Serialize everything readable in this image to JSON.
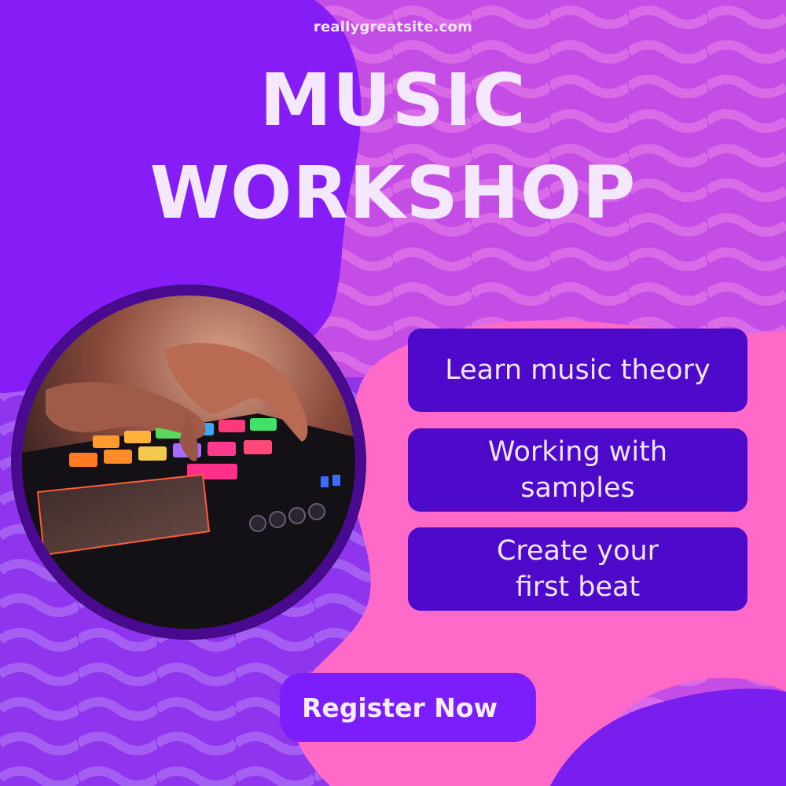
{
  "site": {
    "url": "reallygreatsite.com"
  },
  "headline": {
    "line1": "MUSIC",
    "line2": "WORKSHOP"
  },
  "features": [
    {
      "lines": [
        "Learn music theory"
      ]
    },
    {
      "lines": [
        "Working with",
        "samples"
      ]
    },
    {
      "lines": [
        "Create your",
        "first beat"
      ]
    }
  ],
  "cta": {
    "label": "Register Now"
  },
  "photo": {
    "icon": "drum-machine-photo"
  },
  "colors": {
    "purple_blob": "#861cf6",
    "pink": "#ff6ac8",
    "wave_band": "#a55df2",
    "feature_box": "#4d0acb",
    "cta_button": "#7c1dfb",
    "text_light": "#f3e8ff"
  }
}
